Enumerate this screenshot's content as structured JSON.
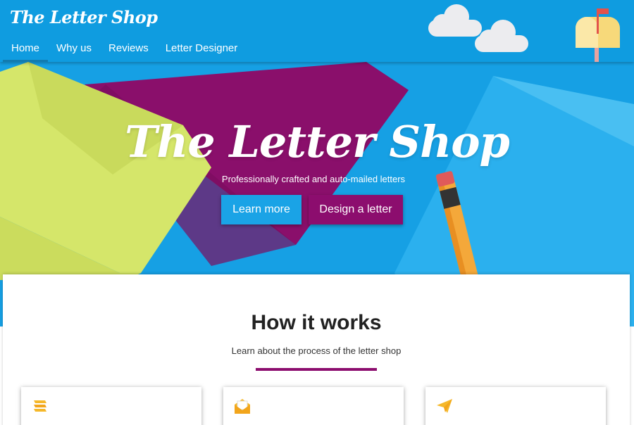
{
  "header": {
    "brand": "The Letter Shop",
    "nav": [
      {
        "label": "Home",
        "active": true
      },
      {
        "label": "Why us",
        "active": false
      },
      {
        "label": "Reviews",
        "active": false
      },
      {
        "label": "Letter Designer",
        "active": false
      }
    ],
    "decor": [
      "cloud-icon",
      "cloud-icon",
      "mailbox-icon"
    ]
  },
  "hero": {
    "title": "The Letter Shop",
    "subtitle": "Professionally crafted and auto-mailed letters",
    "learn_label": "Learn more",
    "design_label": "Design a letter"
  },
  "how": {
    "title": "How it works",
    "subtitle": "Learn about the process of the letter shop",
    "cards": [
      {
        "icon": "stack-icon",
        "title": ""
      },
      {
        "icon": "envelope-icon",
        "title": ""
      },
      {
        "icon": "paper-plane-icon",
        "title": ""
      }
    ]
  },
  "colors": {
    "header_blue": "#0f9ce0",
    "accent_purple": "#8c0d6e",
    "button_blue": "#1aa3e6",
    "icon_yellow": "#f5b82a"
  }
}
